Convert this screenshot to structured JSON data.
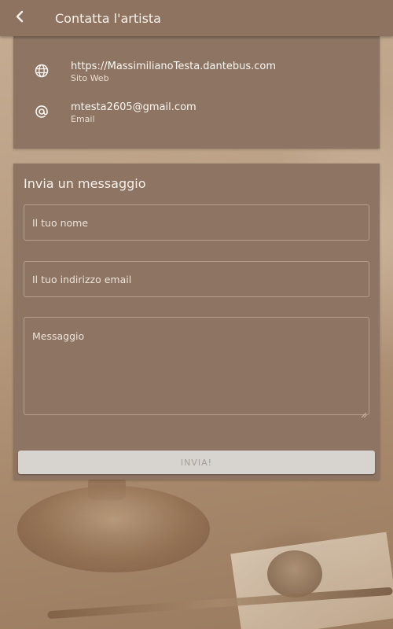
{
  "appbar": {
    "title": "Contatta l'artista",
    "back_icon": "arrow-back-icon"
  },
  "contact_info": [
    {
      "icon": "globe-icon",
      "value": "https://MassimilianoTesta.dantebus.com",
      "label": "Sito Web"
    },
    {
      "icon": "at-sign-icon",
      "value": "mtesta2605@gmail.com",
      "label": "Email"
    }
  ],
  "form": {
    "title": "Invia un messaggio",
    "name_placeholder": "Il tuo nome",
    "email_placeholder": "Il tuo indirizzo email",
    "message_placeholder": "Messaggio",
    "send_label": "INVIA!"
  },
  "colors": {
    "appbar": "#8e7360",
    "card": "#8d7463",
    "button": "#d7d3cf",
    "button_text": "#a59e98"
  }
}
